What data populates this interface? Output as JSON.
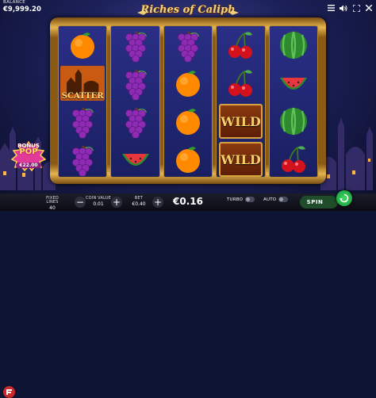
{
  "balance": {
    "label": "BALANCE",
    "value": "€9,999.20"
  },
  "title": "Riches of Caliph",
  "reels": [
    [
      "orange",
      "scatter",
      "grapes",
      "grapes"
    ],
    [
      "grapes",
      "grapes",
      "grapes",
      "watermelon"
    ],
    [
      "grapes",
      "orange",
      "orange",
      "orange"
    ],
    [
      "cherry",
      "cherry",
      "wild",
      "wild"
    ],
    [
      "watermelon",
      "watermelon",
      "watermelon",
      "cherry"
    ]
  ],
  "symbol_labels": {
    "scatter": "SCATTER",
    "wild": "WILD"
  },
  "bonus": {
    "title_line1": "BONUS",
    "title_line2": "POP",
    "amount": "€22.00"
  },
  "bottom": {
    "fixed_lines": {
      "label": "FIXED LINES",
      "value": "40"
    },
    "coin_value": {
      "label": "COIN VALUE",
      "value": "0.01"
    },
    "bet": {
      "label": "BET",
      "value": "€0.40"
    },
    "win": "€0.16",
    "turbo": "TURBO",
    "auto": "AUTO",
    "spin": "SPIN"
  },
  "colors": {
    "frame_gold": "#e5b44e",
    "reel_blue": "#2a2f86",
    "spin_green": "#2fbf55",
    "brand_red": "#c92a2a"
  },
  "icons": [
    "menu-icon",
    "sound-icon",
    "fullscreen-icon",
    "close-icon",
    "logo-icon",
    "spin-arrows-icon"
  ]
}
